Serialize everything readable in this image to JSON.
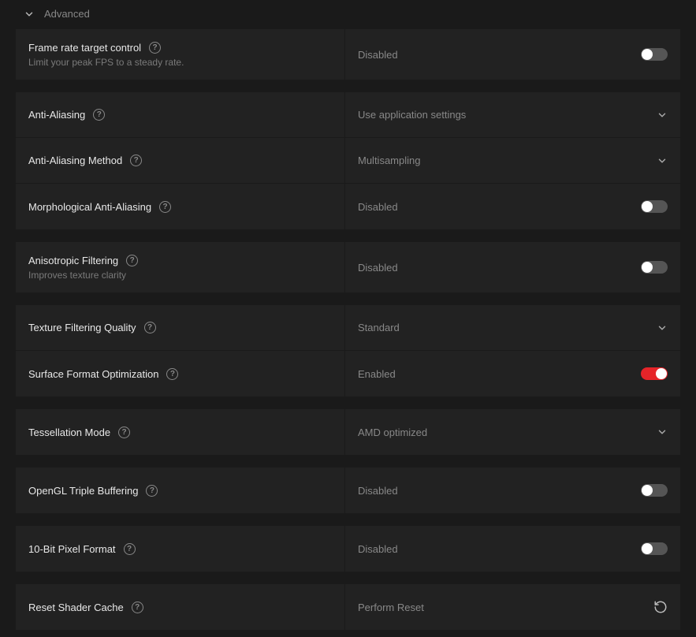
{
  "header": {
    "title": "Advanced"
  },
  "frameRate": {
    "label": "Frame rate target control",
    "sublabel": "Limit your peak FPS to a steady rate.",
    "value": "Disabled",
    "enabled": false
  },
  "antiAliasing": {
    "label": "Anti-Aliasing",
    "value": "Use application settings"
  },
  "antiAliasingMethod": {
    "label": "Anti-Aliasing Method",
    "value": "Multisampling"
  },
  "morphAA": {
    "label": "Morphological Anti-Aliasing",
    "value": "Disabled",
    "enabled": false
  },
  "anisotropic": {
    "label": "Anisotropic Filtering",
    "sublabel": "Improves texture clarity",
    "value": "Disabled",
    "enabled": false
  },
  "textureQuality": {
    "label": "Texture Filtering Quality",
    "value": "Standard"
  },
  "surfaceFormat": {
    "label": "Surface Format Optimization",
    "value": "Enabled",
    "enabled": true
  },
  "tessellation": {
    "label": "Tessellation Mode",
    "value": "AMD optimized"
  },
  "openglTriple": {
    "label": "OpenGL Triple Buffering",
    "value": "Disabled",
    "enabled": false
  },
  "pixelFormat": {
    "label": "10-Bit Pixel Format",
    "value": "Disabled",
    "enabled": false
  },
  "resetShader": {
    "label": "Reset Shader Cache",
    "value": "Perform Reset"
  }
}
